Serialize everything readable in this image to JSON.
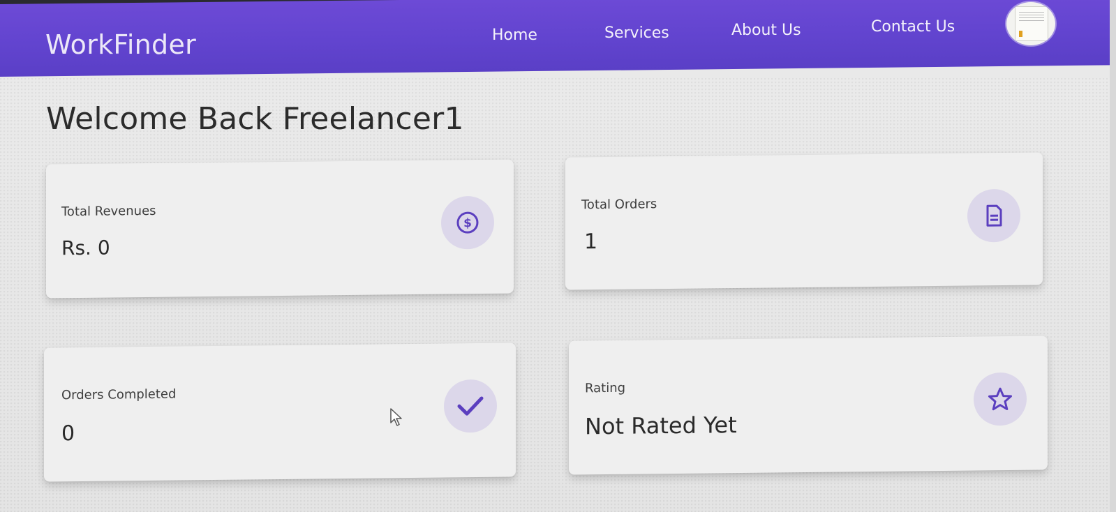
{
  "app": {
    "brand": "WorkFinder"
  },
  "nav": {
    "home": "Home",
    "services": "Services",
    "about": "About Us",
    "contact": "Contact Us"
  },
  "page": {
    "welcome": "Welcome Back Freelancer1"
  },
  "stats": {
    "revenue": {
      "label": "Total Revenues",
      "value": "Rs. 0",
      "icon": "dollar-circle-icon"
    },
    "orders": {
      "label": "Total Orders",
      "value": "1",
      "icon": "document-icon"
    },
    "completed": {
      "label": "Orders Completed",
      "value": "0",
      "icon": "check-icon"
    },
    "rating": {
      "label": "Rating",
      "value": "Not Rated Yet",
      "icon": "star-icon"
    }
  },
  "colors": {
    "primary": "#6244cf",
    "icon_accent": "#5b3fbf",
    "icon_bg": "#dcd7ea"
  }
}
